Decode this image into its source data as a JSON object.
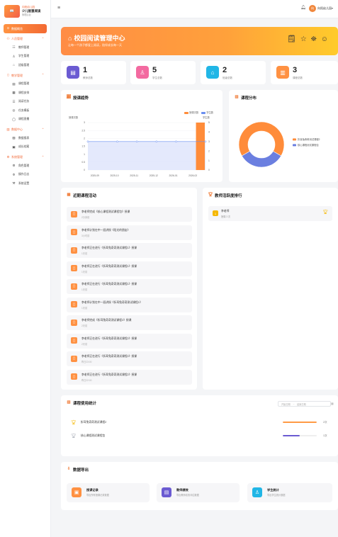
{
  "brand": {
    "line1": "向阳幼儿园",
    "line2": "少儿智慧阅读",
    "line3": "管理后台",
    "logo_text": "📖"
  },
  "sidebar": {
    "active": {
      "label": "数据概览",
      "icon": "dashboard-icon"
    },
    "groups": [
      {
        "label": "人员管理",
        "icon": "users-icon",
        "items": [
          {
            "label": "教师管理",
            "icon": "teacher-icon"
          },
          {
            "label": "学生管理",
            "icon": "student-icon"
          },
          {
            "label": "班级管理",
            "icon": "class-icon"
          }
        ]
      },
      {
        "label": "教学管理",
        "icon": "book-icon",
        "items": [
          {
            "label": "课程管理",
            "icon": "course-icon"
          },
          {
            "label": "课程安排",
            "icon": "schedule-icon"
          },
          {
            "label": "阅读任务",
            "icon": "task-icon"
          },
          {
            "label": "任务模板",
            "icon": "template-icon"
          },
          {
            "label": "课程直播",
            "icon": "live-icon"
          }
        ]
      },
      {
        "label": "数据中心",
        "icon": "data-icon",
        "items": [
          {
            "label": "数据报表",
            "icon": "report-icon"
          },
          {
            "label": "成长档案",
            "icon": "archive-icon"
          }
        ]
      },
      {
        "label": "系统管理",
        "icon": "settings-icon",
        "items": [
          {
            "label": "角色管理",
            "icon": "role-icon"
          },
          {
            "label": "操作日志",
            "icon": "log-icon"
          },
          {
            "label": "系统设置",
            "icon": "gear-icon"
          }
        ]
      }
    ]
  },
  "topbar": {
    "user": "向阳幼儿园",
    "avatar": "向"
  },
  "hero": {
    "title": "校园阅读管理中心",
    "subtitle": "让每一个孩子都爱上阅读，陪伴成长每一天"
  },
  "stats": [
    {
      "value": "1",
      "label": "教师总数",
      "color": "#6b5bd2",
      "icon": "teacher-icon"
    },
    {
      "value": "5",
      "label": "学生总数",
      "color": "#f36aa0",
      "icon": "student-icon"
    },
    {
      "value": "2",
      "label": "班级总数",
      "color": "#21b6e6",
      "icon": "home-icon"
    },
    {
      "value": "3",
      "label": "课程总数",
      "color": "#ff9142",
      "icon": "book-icon"
    }
  ],
  "trend": {
    "title": "授课趋势",
    "chart_data": {
      "type": "bar",
      "categories": [
        "2025-09",
        "2025-10",
        "2025-11",
        "2025-12",
        "2026-01",
        "2026-02"
      ],
      "series": [
        {
          "name": "授课次数",
          "values": [
            0,
            0,
            0,
            0,
            0,
            3
          ],
          "color": "#ff8c3a"
        },
        {
          "name": "学生数",
          "values": [
            3,
            3,
            3,
            3,
            3,
            3
          ],
          "color": "#6a8ff0"
        }
      ],
      "ylabel": "授课次数",
      "y2label": "学生数",
      "ylim": [
        0,
        3
      ],
      "y2lim": [
        0,
        5
      ],
      "yticks": [
        "3",
        "2.5",
        "2",
        "1.5",
        "1",
        "0.5",
        "0"
      ],
      "y2ticks": [
        "5",
        "4",
        "3",
        "2",
        "1",
        "0"
      ]
    }
  },
  "distribution": {
    "title": "课程分布",
    "chart_data": {
      "type": "pie",
      "labels": [
        "折耳兔奇奇测试课程2",
        "核心课程测试课程包"
      ],
      "values": [
        2,
        1
      ],
      "colors": [
        "#ff8c3a",
        "#6b7fe0"
      ]
    }
  },
  "activities": {
    "title": "近期课程活动",
    "items": [
      {
        "text": "李老师完成《核心课程测试课程包》授课",
        "time": "2分钟前"
      },
      {
        "text": "李老师计划在中一班讲授《阳光的朋友》",
        "time": "3小时前"
      },
      {
        "text": "李老师正在进行《折耳兔奇奇测试课程1》授课",
        "time": "1天前"
      },
      {
        "text": "李老师正在进行《折耳兔奇奇测试课程1》授课",
        "time": "1天前"
      },
      {
        "text": "李老师正在进行《折耳兔奇奇测试课程1》授课",
        "time": "1天前"
      },
      {
        "text": "李老师计划在中一班讲授《折耳兔奇奇测试课程1》",
        "time": "1天前"
      },
      {
        "text": "李老师完成《折耳兔奇奇测试课程2》授课",
        "time": "2天前"
      },
      {
        "text": "李老师正在进行《折耳兔奇奇测试课程2》授课",
        "time": "2天前"
      },
      {
        "text": "李老师正在进行《折耳兔奇奇测试课程2》授课",
        "time": "昨日23:00"
      },
      {
        "text": "李老师正在进行《折耳兔奇奇测试课程2》授课",
        "time": "昨日22:00"
      }
    ]
  },
  "ranking": {
    "title": "教师活跃度排行",
    "items": [
      {
        "name": "李老师",
        "meta": "授课 3 次"
      }
    ]
  },
  "course_stats": {
    "title": "课程使用统计",
    "start_placeholder": "开始日期",
    "separator": "→",
    "end_placeholder": "结束日期",
    "rows": [
      {
        "name": "折耳兔奇奇测试课程2",
        "value": "2次",
        "fraction": 1.0,
        "color": "#ff9a45"
      },
      {
        "name": "核心课程测试课程包",
        "value": "1次",
        "fraction": 0.5,
        "color": "#6b5bd2"
      }
    ]
  },
  "export": {
    "title": "数据导出",
    "items": [
      {
        "title": "授课记录",
        "desc": "导出所有授课记录数据",
        "color": "#ff9142",
        "icon": "record-icon"
      },
      {
        "title": "教师绩效",
        "desc": "导出教师绩效评估数据",
        "color": "#6b5bd2",
        "icon": "performance-icon"
      },
      {
        "title": "学生统计",
        "desc": "导出学生统计数据",
        "color": "#21b6e6",
        "icon": "student-icon"
      }
    ]
  }
}
